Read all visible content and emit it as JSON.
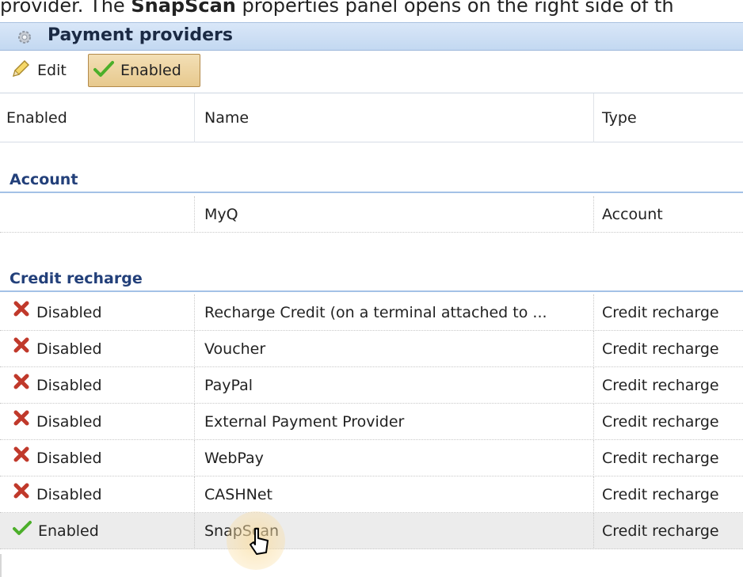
{
  "caption": {
    "prefix": "provider. The ",
    "bold": "SnapScan",
    "suffix": " properties panel opens on the right side of th"
  },
  "window": {
    "title": "Payment providers",
    "icon": "gear-icon"
  },
  "toolbar": {
    "edit_label": "Edit",
    "enabled_label": "Enabled"
  },
  "columns": {
    "enabled": "Enabled",
    "name": "Name",
    "type": "Type"
  },
  "groups": {
    "account": {
      "label": "Account",
      "rows": [
        {
          "enabled": "",
          "name": "MyQ",
          "type": "Account"
        }
      ]
    },
    "credit": {
      "label": "Credit recharge",
      "rows": [
        {
          "enabled": "Disabled",
          "name": "Recharge Credit (on a terminal attached to ...",
          "type": "Credit recharge"
        },
        {
          "enabled": "Disabled",
          "name": "Voucher",
          "type": "Credit recharge"
        },
        {
          "enabled": "Disabled",
          "name": "PayPal",
          "type": "Credit recharge"
        },
        {
          "enabled": "Disabled",
          "name": "External Payment Provider",
          "type": "Credit recharge"
        },
        {
          "enabled": "Disabled",
          "name": "WebPay",
          "type": "Credit recharge"
        },
        {
          "enabled": "Disabled",
          "name": "CASHNet",
          "type": "Credit recharge"
        },
        {
          "enabled": "Enabled",
          "name": "SnapScan",
          "type": "Credit recharge"
        }
      ]
    }
  },
  "colors": {
    "accent": "#23407a",
    "disabled": "#c0392b",
    "enabled": "#4caf2a"
  }
}
